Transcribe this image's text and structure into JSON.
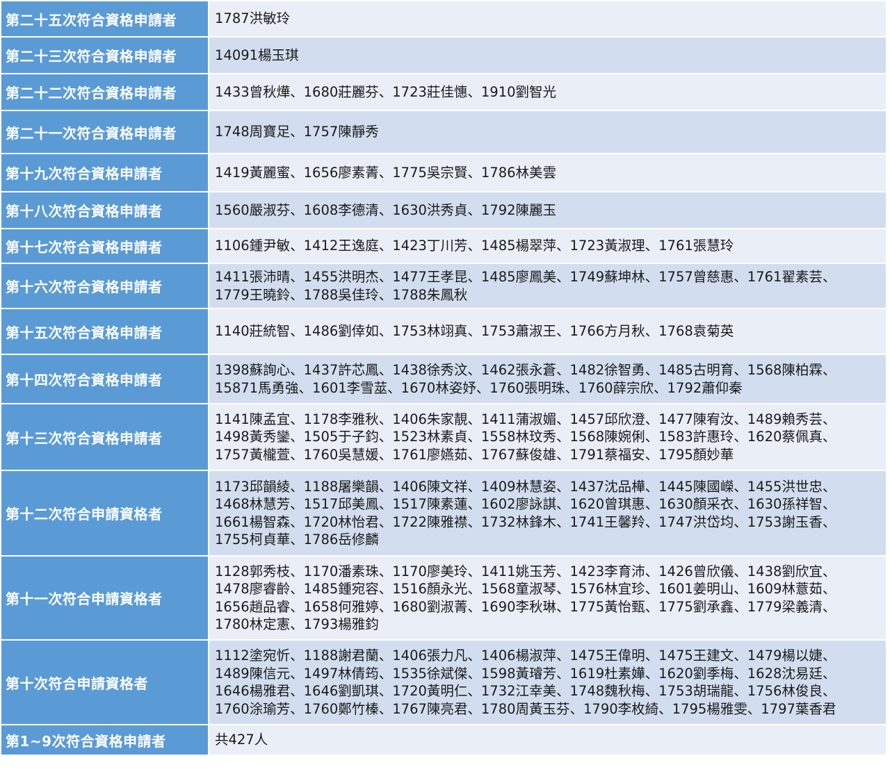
{
  "rows": [
    {
      "label": "第二十五次符合資格申請者",
      "names": "1787洪敏玲"
    },
    {
      "label": "第二十三次符合資格申請者",
      "names": "14091楊玉琪"
    },
    {
      "label": "第二十二次符合資格申請者",
      "names": "1433曾秋燁、1680莊麗芬、1723莊佳憓、1910劉智光"
    },
    {
      "label": "第二十一次符合資格申請者",
      "names": "1748周寶足、1757陳靜秀"
    },
    {
      "label": "第十九次符合資格申請者",
      "names": "1419黃麗蜜、1656廖素菁、1775吳宗賢、1786林美雲"
    },
    {
      "label": "第十八次符合資格申請者",
      "names": "1560嚴淑芬、1608李德清、1630洪秀貞、1792陳麗玉"
    },
    {
      "label": "第十七次符合資格申請者",
      "names": "1106鍾尹敏、1412王逸庭、1423丁川芳、1485楊翠萍、1723黃淑理、1761張慧玲"
    },
    {
      "label": "第十六次符合資格申請者",
      "names": "1411張沛晴、1455洪明杰、1477王孝昆、1485廖鳳美、1749蘇坤林、1757曾慈惠、1761翟素芸、\n1779王曉鈴、1788吳佳玲、1788朱鳳秋"
    },
    {
      "label": "第十五次符合資格申請者",
      "names": "1140莊統智、1486劉倖如、1753林翊真、1753蕭淑王、1766方月秋、1768袁菊英"
    },
    {
      "label": "第十四次符合資格申請者",
      "names": "1398蘇詢心、1437許芯鳳、1438徐秀汶、1462張永蒼、1482徐智勇、1485古明育、1568陳柏霖、\n15871馬勇強、1601李雪莁、1670林姿妤、1760張明珠、1760薛宗欣、1792蕭仰秦"
    },
    {
      "label": "第十三次符合資格申請者",
      "names": "1141陳孟宜、1178李雅秋、1406朱家靚、1411蒲淑媚、1457邱欣澄、1477陳宥汝、1489賴秀芸、\n1498黃秀鑾、1505于子鈞、1523林素貞、1558林玟秀、1568陳婉俐、1583許惠玲、1620蔡佩真、\n1757黃櫳萱、1760吳慧媛、1761廖嬿茹、1767蘇俊雄、1791蔡福安、1795顏妙華"
    },
    {
      "label": "第十二次符合申請資格者",
      "names": "1173邱韻綾、1188屠樂韻、1406陳文祥、1409林慧姿、1437沈品樺、1445陳國嶸、1455洪世忠、\n1468林慧芳、1517邱美鳳、1517陳素蓮、1602廖詠諆、1620曾琪惠、1630顏采衣、1630孫祥智、\n1661楊智森、1720林怡君、1722陳雅襟、1732林鋒木、1741王馨羚、1747洪岱均、1753謝玉香、\n1755柯貞華、1786岳修麟"
    },
    {
      "label": "第十一次符合申請資格者",
      "names": "1128郭秀枝、1170潘素珠、1170廖美玲、1411姚玉芳、1423李育沛、1426曾欣儀、1438劉欣宜、\n1478廖睿齡、1485鍾宛容、1516顏永光、1568童淑琴、1576林宜珍、1601姜明山、1609林薏茹、\n1656趙品睿、1658何雅婷、1680劉淑菁、1690李秋琳、1775黃怡甄、1775劉承鑫、1779梁義清、\n1780林定憲、1793楊雅鈞"
    },
    {
      "label": "第十次符合申請資格者",
      "names": "1112塗宛忻、1188謝君蘭、1406張力凡、1406楊淑萍、1475王偉明、1475王建文、1479楊以婕、\n1489陳信元、1497林倩筠、1535徐斌傑、1598黃璿芳、1619杜素嬅、1620劉季梅、1628沈易廷、\n1646楊雅君、1646劉凱琪、1720黃明仁、1732江幸美、1748魏秋梅、1753胡瑞龍、1756林俊良、\n1760涂瑜芳、1760鄭竹榛、1767陳亮君、1780周黃玉芬、1790李枚綺、1795楊雅雯、1797葉香君"
    },
    {
      "label": "第1~9次符合資格申請者",
      "names": "共427人"
    }
  ]
}
